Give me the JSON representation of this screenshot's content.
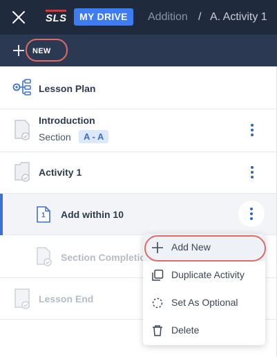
{
  "header": {
    "logo": "SLS",
    "drive_label": "MY DRIVE",
    "breadcrumb": [
      "Addition",
      "A. Activity 1"
    ],
    "separator": "/"
  },
  "toolbar": {
    "new_label": "NEW"
  },
  "items": [
    {
      "title": "Lesson Plan"
    },
    {
      "title": "Introduction",
      "sub": "Section",
      "chip": "A - A"
    },
    {
      "title": "Activity 1"
    },
    {
      "title": "Add within 10",
      "page_number": "1"
    },
    {
      "title": "Section Completion"
    },
    {
      "title": "Lesson End"
    }
  ],
  "menu": {
    "items": [
      {
        "label": "Add New",
        "icon": "plus-icon"
      },
      {
        "label": "Duplicate Activity",
        "icon": "duplicate-icon"
      },
      {
        "label": "Set As Optional",
        "icon": "dashed-circle-icon"
      },
      {
        "label": "Delete",
        "icon": "trash-icon"
      }
    ]
  },
  "colors": {
    "header_bg": "#1f2a3c",
    "toolbar_bg": "#2b3a52",
    "accent": "#3d7cf3",
    "highlight_ring": "#e06a66"
  }
}
